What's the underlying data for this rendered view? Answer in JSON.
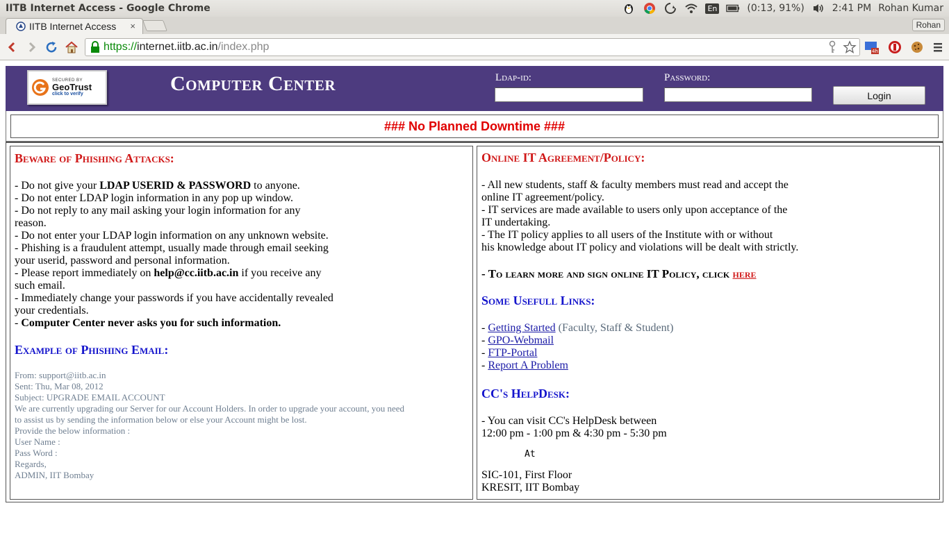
{
  "os": {
    "window_title": "IITB Internet Access - Google Chrome",
    "battery": "(0:13, 91%)",
    "clock": "2:41 PM",
    "user": "Rohan Kumar",
    "lang": "En",
    "icons": [
      "penguin-icon",
      "chrome-icon",
      "sync-icon",
      "wifi-icon",
      "keyboard-lang-icon",
      "battery-icon",
      "volume-icon"
    ]
  },
  "browser": {
    "tab_title": "IITB Internet Access",
    "tab_close": "×",
    "profile": "Rohan",
    "url_scheme": "https://",
    "url_host": "internet.iitb.ac.in",
    "url_path": "/index.php"
  },
  "header": {
    "geotrust_secured": "SECURED BY",
    "geotrust_brand": "GeoTrust",
    "geotrust_verify": "click to verify",
    "title": "Computer Center",
    "ldap_label": "Ldap-id:",
    "password_label": "Password:",
    "login_button": "Login"
  },
  "notice": "### No Planned Downtime ###",
  "left": {
    "phishing_title": "Beware of Phishing Attacks:",
    "l1_a": "- Do not give your ",
    "l1_b": "LDAP USERID & PASSWORD",
    "l1_c": " to anyone.",
    "l2": "- Do not enter LDAP login information in any pop up window.",
    "l3a": "- Do not reply to any mail asking your login information for any",
    "l3b": "reason.",
    "l4": "- Do not enter your LDAP login information on any unknown website.",
    "l5a": "- Phishing is a fraudulent attempt, usually made through email seeking",
    "l5b": "your userid, password and personal information.",
    "l6_a": "- Please report immediately on ",
    "l6_b": "help@cc.iitb.ac.in",
    "l6_c": " if you receive any",
    "l6d": "such email.",
    "l7a": "- Immediately change your passwords if you have accidentally revealed",
    "l7b": "your credentials.",
    "l8_a": "- ",
    "l8_b": "Computer Center never asks you for such information.",
    "example_title": "Example of Phishing Email:",
    "email": [
      "From: support@iitb.ac.in",
      "Sent: Thu, Mar 08, 2012",
      "Subject: UPGRADE EMAIL ACCOUNT",
      "We are currently upgrading our Server for our Account Holders. In order to upgrade your account, you need",
      "to assist us by sending the information below or else your Account might be lost.",
      "Provide the below information :",
      "User Name :",
      "Pass Word :",
      "Regards,",
      "ADMIN, IIT Bombay"
    ]
  },
  "right": {
    "policy_title": "Online IT Agreement/Policy:",
    "p1a": "- All new students, staff & faculty members must read and accept the",
    "p1b": "online IT agreement/policy.",
    "p2a": "- IT services are made available to users only upon acceptance of the",
    "p2b": "IT undertaking.",
    "p3a": "- The IT policy applies to all users of the Institute with or without",
    "p3b": "his knowledge about IT policy and violations will be dealt with strictly.",
    "learn_text": "- To learn more and sign online IT Policy, click ",
    "learn_link": "here",
    "links_title": "Some Usefull Links:",
    "dash": "- ",
    "link1": "Getting Started",
    "link1_note": " (Faculty, Staff & Student)",
    "link2": "GPO-Webmail",
    "link3": "FTP-Portal",
    "link4": "Report A Problem",
    "helpdesk_title": "CC's HelpDesk:",
    "h1": "- You can visit CC's HelpDesk between",
    "h2": "12:00 pm - 1:00 pm & 4:30 pm - 5:30 pm",
    "at": "At",
    "h3": "SIC-101, First Floor",
    "h4": "KRESIT, IIT Bombay"
  }
}
